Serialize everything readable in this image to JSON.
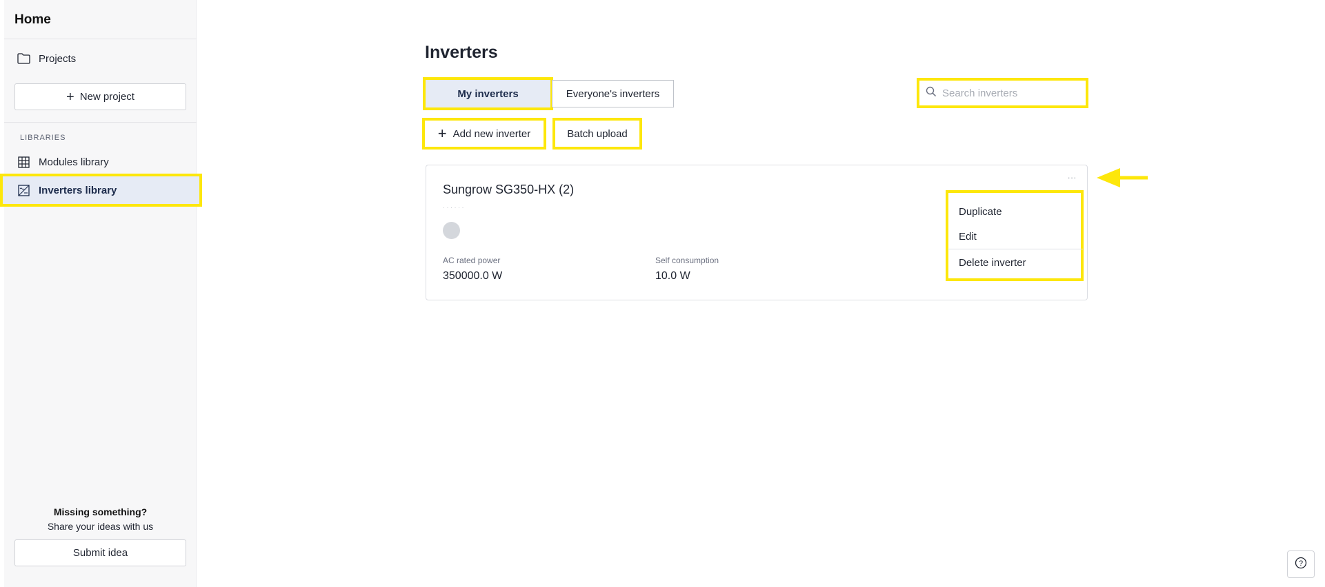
{
  "sidebar": {
    "home_title": "Home",
    "projects_label": "Projects",
    "new_project_label": "New project",
    "libraries_heading": "LIBRARIES",
    "modules_library_label": "Modules library",
    "inverters_library_label": "Inverters library",
    "missing_title": "Missing something?",
    "missing_subtitle": "Share your ideas with us",
    "submit_idea_label": "Submit idea"
  },
  "main": {
    "title": "Inverters",
    "tabs": [
      {
        "label": "My inverters",
        "active": true
      },
      {
        "label": "Everyone's inverters",
        "active": false
      }
    ],
    "search": {
      "placeholder": "Search inverters",
      "value": ""
    },
    "add_new_label": "Add new inverter",
    "batch_upload_label": "Batch upload",
    "card": {
      "title": "Sungrow SG350-HX (2)",
      "more_label": "...",
      "stats": [
        {
          "label": "AC rated power",
          "value": "350000.0 W"
        },
        {
          "label": "Self consumption",
          "value": "10.0 W"
        }
      ]
    },
    "menu": {
      "items": [
        "Duplicate",
        "Edit",
        "Delete inverter"
      ]
    },
    "help_label": "?"
  },
  "colors": {
    "highlight": "#fde70b",
    "active_bg": "#e6ebf5",
    "sidebar_bg": "#f7f7f8"
  }
}
